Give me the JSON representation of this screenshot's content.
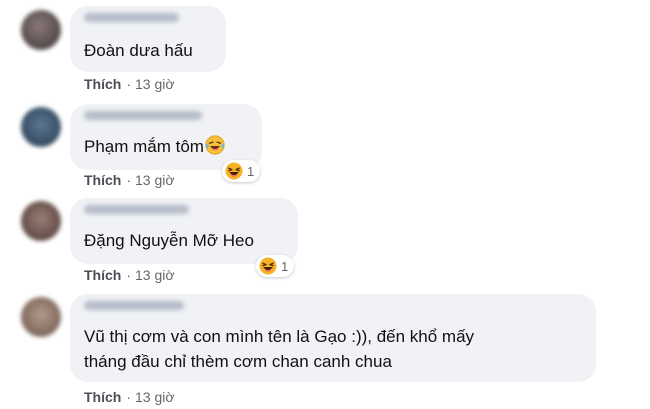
{
  "comments": [
    {
      "text": "Đoàn dưa hấu",
      "like_label": "Thích",
      "time": "13 giờ"
    },
    {
      "text": "Phạm mắm tôm",
      "inline_emoji": "laughing-tears-emoji",
      "like_label": "Thích",
      "time": "13 giờ",
      "reaction": {
        "icon": "haha-reaction-icon",
        "count": "1"
      }
    },
    {
      "text": "Đặng Nguyễn Mỡ Heo",
      "like_label": "Thích",
      "time": "13 giờ",
      "reaction": {
        "icon": "haha-reaction-icon",
        "count": "1"
      }
    },
    {
      "text_line1": "Vũ thị cơm và con mình tên là Gạo :)), đến khổ mấy",
      "text_line2": "tháng đầu chỉ thèm cơm chan canh chua",
      "like_label": "Thích",
      "time": "13 giờ"
    }
  ],
  "colors": {
    "bubble": "#f0f2f5",
    "meta_text": "#65676b",
    "reaction_yellow": "#f7b125"
  }
}
